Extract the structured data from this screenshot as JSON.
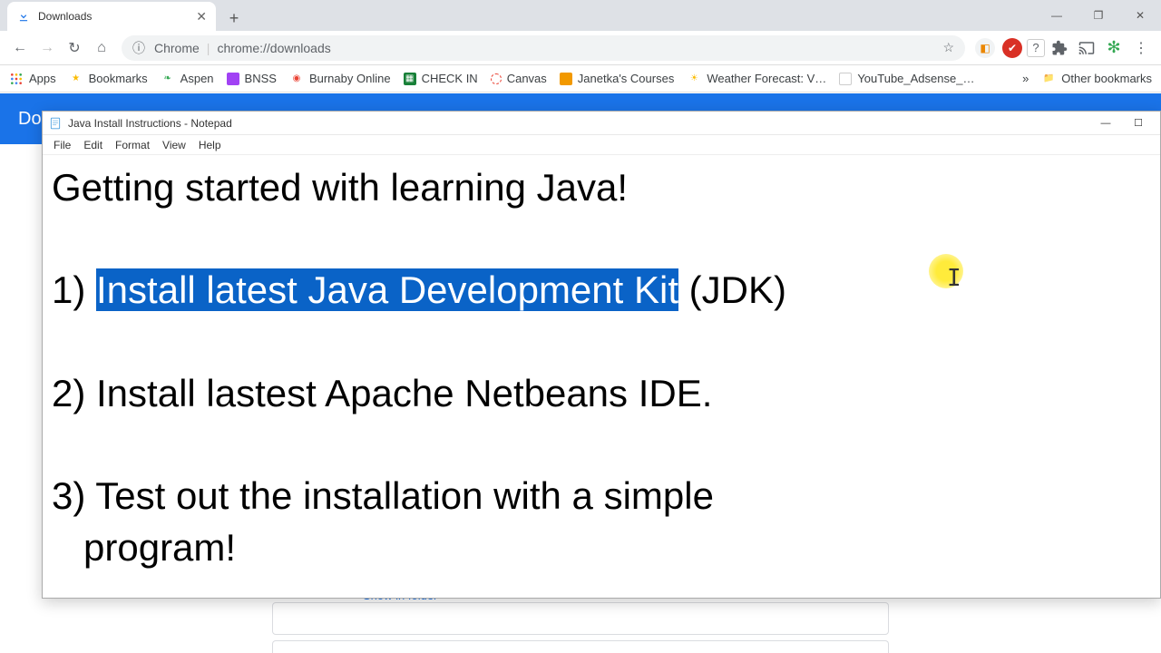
{
  "browser": {
    "tab_title": "Downloads",
    "new_tab": "+",
    "window": {
      "min": "—",
      "max": "❐",
      "close": "✕"
    },
    "nav": {
      "back": "←",
      "forward": "→",
      "reload": "↻",
      "home": "⌂"
    },
    "address": {
      "secure": "ⓘ",
      "origin": "Chrome",
      "url": "chrome://downloads",
      "star": "☆"
    }
  },
  "bookmarks": {
    "apps": "Apps",
    "items": [
      {
        "label": "Bookmarks",
        "color": "#fbbc04"
      },
      {
        "label": "Aspen",
        "color": "#34a853"
      },
      {
        "label": "BNSS",
        "color": "#a142f4"
      },
      {
        "label": "Burnaby Online",
        "color": "#ea4335"
      },
      {
        "label": "CHECK IN",
        "color": "#188038"
      },
      {
        "label": "Canvas",
        "color": "#ea4335"
      },
      {
        "label": "Janetka's Courses",
        "color": "#f29900"
      },
      {
        "label": "Weather Forecast: V…",
        "color": "#fbbc04"
      },
      {
        "label": "YouTube_Adsense_…",
        "color": "#ea4335"
      }
    ],
    "overflow": "»",
    "other": "Other bookmarks"
  },
  "downloads_page": {
    "header": "Do",
    "show_in_folder": "Show in folder"
  },
  "notepad": {
    "title": "Java Install Instructions - Notepad",
    "menu": [
      "File",
      "Edit",
      "Format",
      "View",
      "Help"
    ],
    "window": {
      "min": "—",
      "max": "☐",
      "close": "✕"
    },
    "content": {
      "heading": "Getting started with learning Java!",
      "item1_prefix": "1) ",
      "item1_selected": "Install latest Java Development Kit",
      "item1_suffix": " (JDK)",
      "item2": "2) Install lastest Apache Netbeans IDE.",
      "item3": "3) Test out the installation with a simple\n   program!"
    }
  }
}
